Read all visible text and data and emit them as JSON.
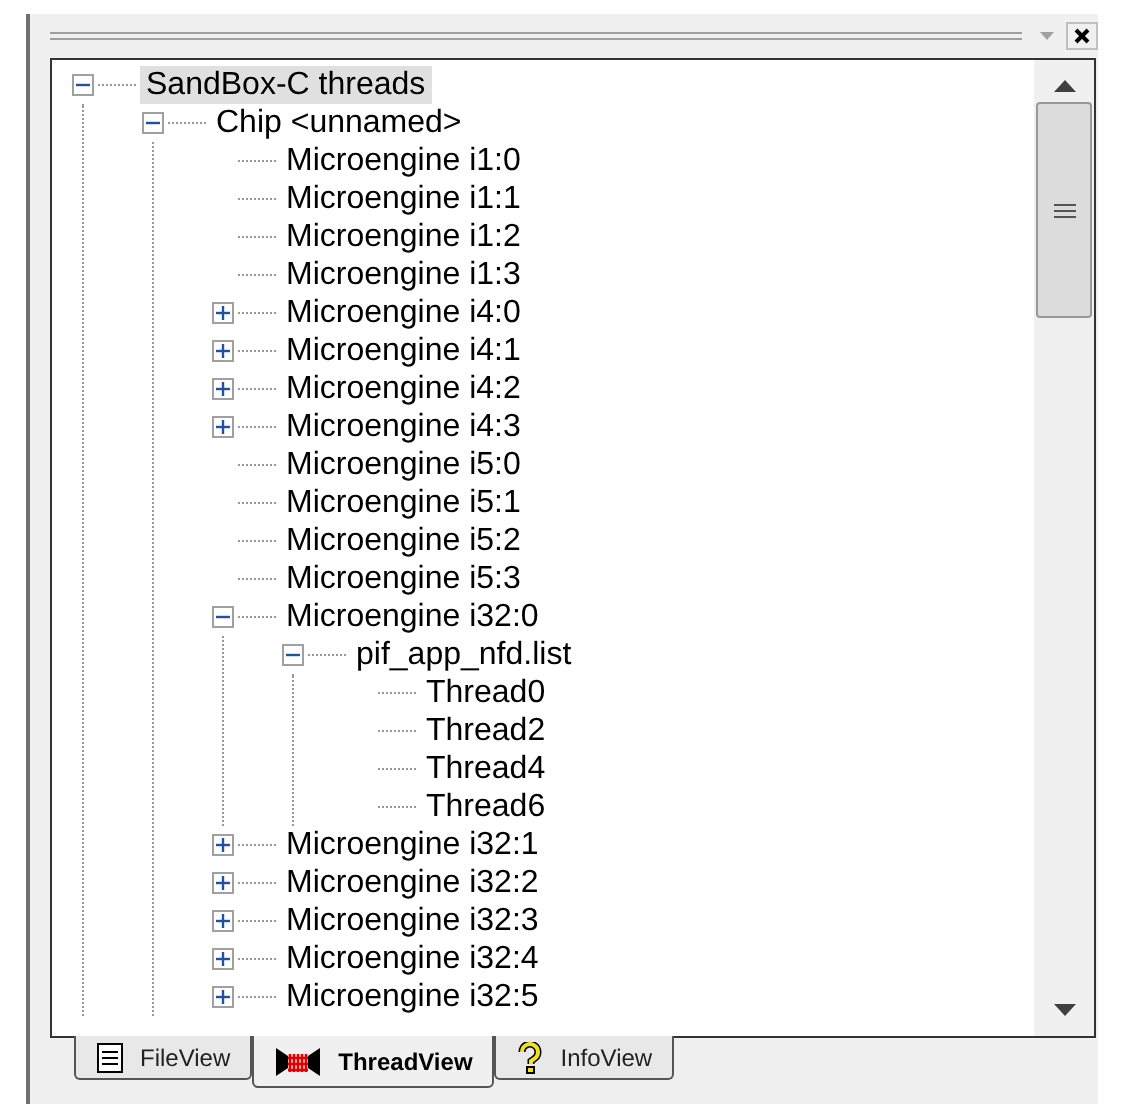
{
  "tree": [
    {
      "label": "SandBox-C threads",
      "selected": true,
      "expanded": true,
      "children": [
        {
          "label": "Chip <unnamed>",
          "selected": false,
          "expanded": true,
          "children": [
            {
              "label": "Microengine i1:0",
              "selected": false
            },
            {
              "label": "Microengine i1:1",
              "selected": false
            },
            {
              "label": "Microengine i1:2",
              "selected": false
            },
            {
              "label": "Microengine i1:3",
              "selected": false
            },
            {
              "label": "Microengine i4:0",
              "selected": false,
              "expanded": false
            },
            {
              "label": "Microengine i4:1",
              "selected": false,
              "expanded": false
            },
            {
              "label": "Microengine i4:2",
              "selected": false,
              "expanded": false
            },
            {
              "label": "Microengine i4:3",
              "selected": false,
              "expanded": false
            },
            {
              "label": "Microengine i5:0",
              "selected": false
            },
            {
              "label": "Microengine i5:1",
              "selected": false
            },
            {
              "label": "Microengine i5:2",
              "selected": false
            },
            {
              "label": "Microengine i5:3",
              "selected": false
            },
            {
              "label": "Microengine i32:0",
              "selected": false,
              "expanded": true,
              "children": [
                {
                  "label": "pif_app_nfd.list",
                  "selected": false,
                  "expanded": true,
                  "children": [
                    {
                      "label": "Thread0",
                      "selected": false
                    },
                    {
                      "label": "Thread2",
                      "selected": false
                    },
                    {
                      "label": "Thread4",
                      "selected": false
                    },
                    {
                      "label": "Thread6",
                      "selected": false
                    }
                  ]
                }
              ]
            },
            {
              "label": "Microengine i32:1",
              "selected": false,
              "expanded": false
            },
            {
              "label": "Microengine i32:2",
              "selected": false,
              "expanded": false
            },
            {
              "label": "Microengine i32:3",
              "selected": false,
              "expanded": false
            },
            {
              "label": "Microengine i32:4",
              "selected": false,
              "expanded": false
            },
            {
              "label": "Microengine i32:5",
              "selected": false,
              "expanded": false
            }
          ]
        }
      ]
    }
  ],
  "tabs": [
    {
      "label": "FileView",
      "kind": "file",
      "selected": false
    },
    {
      "label": "ThreadView",
      "kind": "thread",
      "selected": true
    },
    {
      "label": "InfoView",
      "kind": "info",
      "selected": false
    }
  ]
}
